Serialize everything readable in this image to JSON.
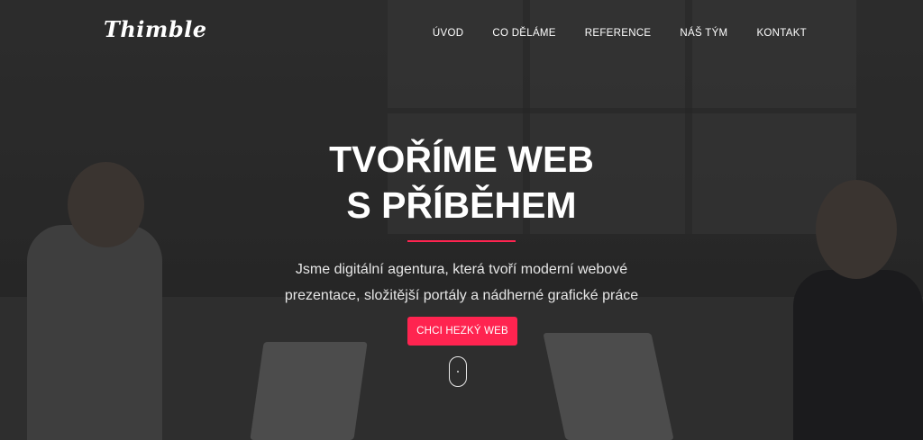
{
  "header": {
    "logo_text": "Thimble",
    "nav": [
      {
        "label": "ÚVOD"
      },
      {
        "label": "CO DĚLÁME"
      },
      {
        "label": "REFERENCE"
      },
      {
        "label": "NÁŠ TÝM"
      },
      {
        "label": "KONTAKT"
      }
    ]
  },
  "hero": {
    "headline_line1": "TVOŘÍME WEB",
    "headline_line2": "S PŘÍBĚHEM",
    "subtitle_line1": "Jsme digitální agentura, která tvoří moderní webové",
    "subtitle_line2": "prezentace, složitější portály a nádherné grafické práce",
    "cta_label": "CHCI HEZKÝ WEB",
    "accent_color": "#ff2450",
    "scroll_indicator_icon": "mouse-scroll-icon"
  }
}
